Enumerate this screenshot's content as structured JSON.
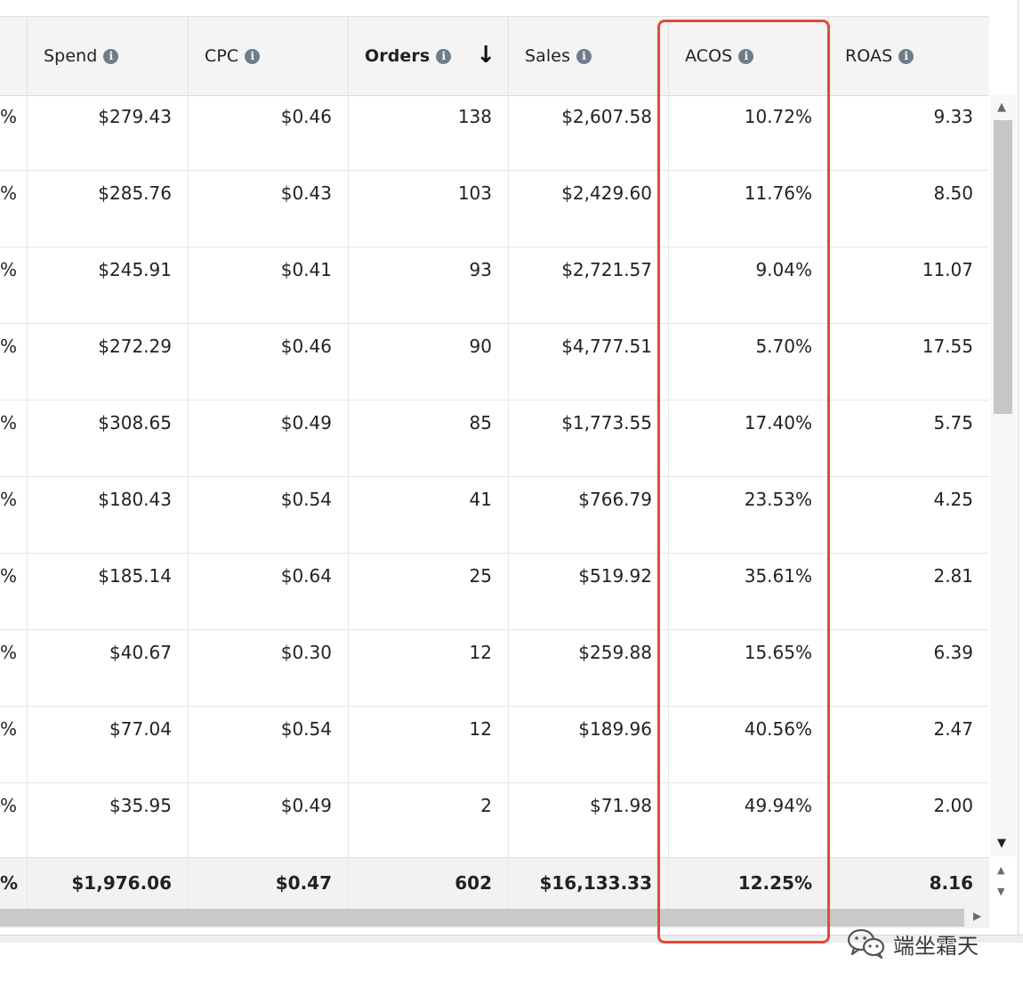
{
  "columns": [
    {
      "label": "Spend"
    },
    {
      "label": "CPC"
    },
    {
      "label": "Orders",
      "sorted": "desc"
    },
    {
      "label": "Sales"
    },
    {
      "label": "ACOS"
    },
    {
      "label": "ROAS"
    }
  ],
  "info_glyph": "i",
  "sort_glyph": "↓",
  "rows": [
    {
      "prev": "%",
      "spend": "$279.43",
      "cpc": "$0.46",
      "orders": "138",
      "sales": "$2,607.58",
      "acos": "10.72%",
      "roas": "9.33"
    },
    {
      "prev": "%",
      "spend": "$285.76",
      "cpc": "$0.43",
      "orders": "103",
      "sales": "$2,429.60",
      "acos": "11.76%",
      "roas": "8.50"
    },
    {
      "prev": "%",
      "spend": "$245.91",
      "cpc": "$0.41",
      "orders": "93",
      "sales": "$2,721.57",
      "acos": "9.04%",
      "roas": "11.07"
    },
    {
      "prev": "%",
      "spend": "$272.29",
      "cpc": "$0.46",
      "orders": "90",
      "sales": "$4,777.51",
      "acos": "5.70%",
      "roas": "17.55"
    },
    {
      "prev": "%",
      "spend": "$308.65",
      "cpc": "$0.49",
      "orders": "85",
      "sales": "$1,773.55",
      "acos": "17.40%",
      "roas": "5.75"
    },
    {
      "prev": "%",
      "spend": "$180.43",
      "cpc": "$0.54",
      "orders": "41",
      "sales": "$766.79",
      "acos": "23.53%",
      "roas": "4.25"
    },
    {
      "prev": "%",
      "spend": "$185.14",
      "cpc": "$0.64",
      "orders": "25",
      "sales": "$519.92",
      "acos": "35.61%",
      "roas": "2.81"
    },
    {
      "prev": "%",
      "spend": "$40.67",
      "cpc": "$0.30",
      "orders": "12",
      "sales": "$259.88",
      "acos": "15.65%",
      "roas": "6.39"
    },
    {
      "prev": "%",
      "spend": "$77.04",
      "cpc": "$0.54",
      "orders": "12",
      "sales": "$189.96",
      "acos": "40.56%",
      "roas": "2.47"
    },
    {
      "prev": "%",
      "spend": "$35.95",
      "cpc": "$0.49",
      "orders": "2",
      "sales": "$71.98",
      "acos": "49.94%",
      "roas": "2.00"
    }
  ],
  "totals": {
    "prev": "%",
    "spend": "$1,976.06",
    "cpc": "$0.47",
    "orders": "602",
    "sales": "$16,133.33",
    "acos": "12.25%",
    "roas": "8.16"
  },
  "highlight_color": "#e04a3c",
  "watermark": "端坐霜天"
}
